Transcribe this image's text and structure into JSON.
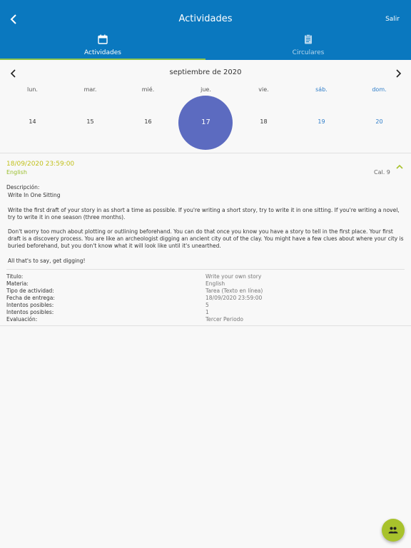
{
  "header": {
    "title": "Actividades",
    "logout_label": "Salir"
  },
  "tabs": [
    {
      "label": "Actividades",
      "icon": "calendar-icon",
      "active": true
    },
    {
      "label": "Circulares",
      "icon": "clipboard-icon",
      "active": false
    }
  ],
  "calendar": {
    "month_label": "septiembre de 2020",
    "weekdays": [
      "lun.",
      "mar.",
      "mié.",
      "jue.",
      "vie.",
      "sáb.",
      "dom."
    ],
    "days": [
      "14",
      "15",
      "16",
      "17",
      "18",
      "19",
      "20"
    ],
    "selected_day": "17",
    "selected_color": "#5c6bc0",
    "weekend_color": "#2e7dc9"
  },
  "activity": {
    "due_date": "18/09/2020 23:59:00",
    "subject": "English",
    "grade": "Cal. 9",
    "description_label": "Descripción:",
    "description_title": "Write In One Sitting",
    "paragraphs": [
      "Write the first draft of your story in as short a time as possible. If you're writing a short story, try to write it in one sitting. If you're writing a novel, try to write it in one season (three months).",
      "Don't worry too much about plotting or outlining beforehand. You can do that once you know you have a story to tell in the first place. Your first draft is a discovery process. You are like an archeologist digging an ancient city out of the clay. You might have a few clues about where your city is buried beforehand, but you don't know what it will look like until it's unearthed.",
      "All that's to say, get digging!"
    ],
    "details": [
      {
        "label": "Titulo:",
        "value": "Write your own story"
      },
      {
        "label": "Materia:",
        "value": "English"
      },
      {
        "label": "Tipo de actividad:",
        "value": "Tarea (Texto en línea)"
      },
      {
        "label": "Fecha de entrega:",
        "value": "18/09/2020 23:59:00"
      },
      {
        "label": "Intentos posibles:",
        "value": "5"
      },
      {
        "label": "Intentos posibles:",
        "value": "1"
      },
      {
        "label": "Evaluación:",
        "value": "Tercer Periodo"
      }
    ]
  },
  "fab": {
    "icon": "group-icon"
  },
  "colors": {
    "header_bg": "#0a78bf",
    "tab_indicator": "#8bc34a",
    "accent_green": "#a8c22c",
    "date_yellow": "#c1c01a"
  }
}
